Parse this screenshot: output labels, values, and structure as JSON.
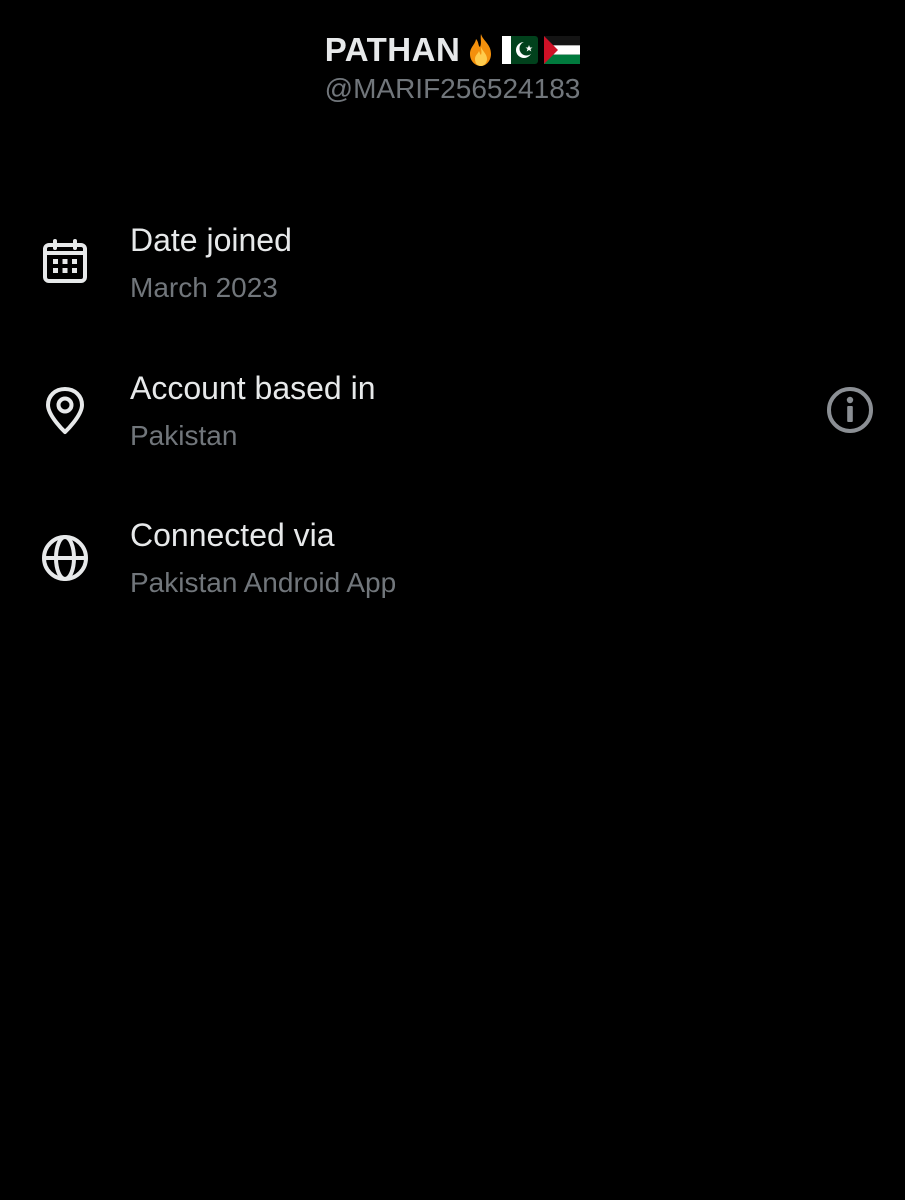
{
  "profile": {
    "display_name": "PATHAN",
    "emojis": [
      "fire-emoji",
      "pakistan-flag-emoji",
      "palestine-flag-emoji"
    ],
    "handle": "@MARIF256524183"
  },
  "details": [
    {
      "icon": "calendar-icon",
      "title": "Date joined",
      "value": "March 2023"
    },
    {
      "icon": "location-pin-icon",
      "title": "Account based in",
      "value": "Pakistan"
    },
    {
      "icon": "globe-icon",
      "title": "Connected via",
      "value": "Pakistan Android App"
    }
  ],
  "colors": {
    "background": "#000000",
    "primary_text": "#e7e9ea",
    "secondary_text": "#71767b"
  }
}
